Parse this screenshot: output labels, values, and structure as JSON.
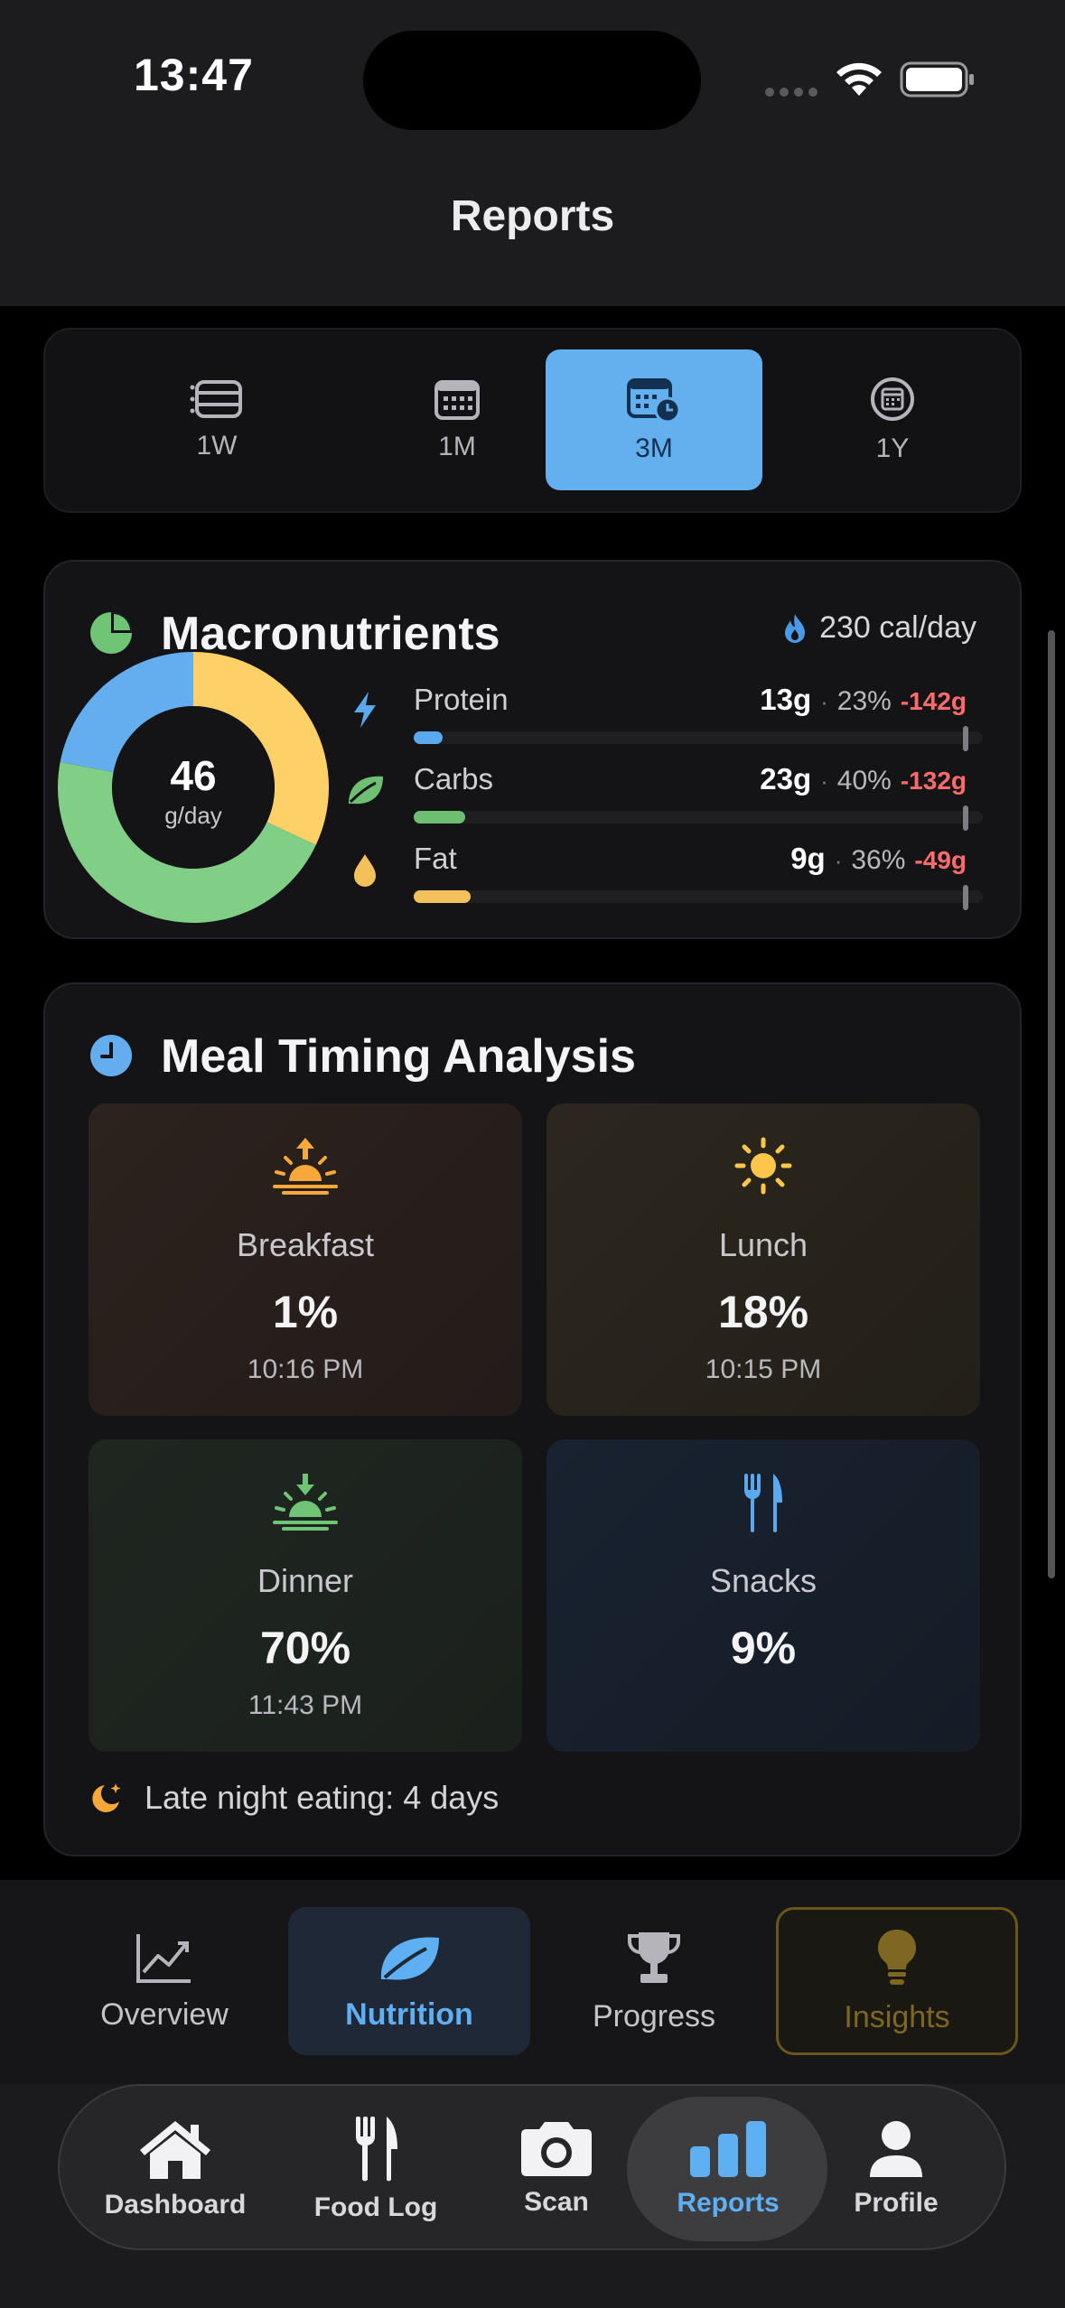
{
  "status_bar": {
    "time": "13:47"
  },
  "nav": {
    "title": "Reports"
  },
  "period": {
    "options": [
      {
        "label": "1W",
        "active": false
      },
      {
        "label": "1M",
        "active": false
      },
      {
        "label": "3M",
        "active": true
      },
      {
        "label": "1Y",
        "active": false
      }
    ]
  },
  "macros": {
    "title": "Macronutrients",
    "calories": "230 cal/day",
    "total_value": "46",
    "total_unit": "g/day",
    "rows": [
      {
        "name": "Protein",
        "grams": "13g",
        "percent": "23%",
        "diff": "-142g",
        "color": "#5aa8ee",
        "progress": 0.05
      },
      {
        "name": "Carbs",
        "grams": "23g",
        "percent": "40%",
        "diff": "-132g",
        "color": "#6fbf73",
        "progress": 0.09
      },
      {
        "name": "Fat",
        "grams": "9g",
        "percent": "36%",
        "diff": "-49g",
        "color": "#f2c15c",
        "progress": 0.1
      }
    ],
    "donut": [
      {
        "name": "Fat",
        "value": 0.32,
        "color": "#fdd168"
      },
      {
        "name": "Carbs",
        "value": 0.46,
        "color": "#81cf86"
      },
      {
        "name": "Protein",
        "value": 0.22,
        "color": "#64adee"
      }
    ]
  },
  "meal_timing": {
    "title": "Meal Timing Analysis",
    "meals": [
      {
        "name": "Breakfast",
        "percent": "1%",
        "time": "10:16 PM"
      },
      {
        "name": "Lunch",
        "percent": "18%",
        "time": "10:15 PM"
      },
      {
        "name": "Dinner",
        "percent": "70%",
        "time": "11:43 PM"
      },
      {
        "name": "Snacks",
        "percent": "9%",
        "time": ""
      }
    ],
    "late_night": "Late night eating: 4 days"
  },
  "section_tabs": [
    {
      "label": "Overview",
      "icon": "chart-line-icon"
    },
    {
      "label": "Nutrition",
      "icon": "leaf-icon",
      "active": true
    },
    {
      "label": "Progress",
      "icon": "trophy-icon"
    },
    {
      "label": "Insights",
      "icon": "lightbulb-icon"
    }
  ],
  "tab_bar": [
    {
      "label": "Dashboard",
      "icon": "house-icon"
    },
    {
      "label": "Food Log",
      "icon": "fork-knife-icon"
    },
    {
      "label": "Scan",
      "icon": "camera-icon"
    },
    {
      "label": "Reports",
      "icon": "bar-chart-icon",
      "active": true
    },
    {
      "label": "Profile",
      "icon": "person-icon"
    }
  ]
}
